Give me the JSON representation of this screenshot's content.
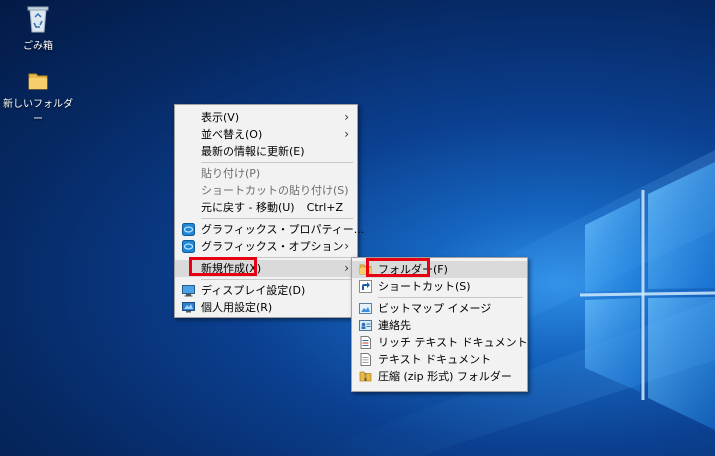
{
  "desktop": {
    "icons": [
      {
        "label": "ごみ箱",
        "icon": "recycle-bin-icon"
      },
      {
        "label": "新しいフォルダー",
        "icon": "folder-icon"
      }
    ]
  },
  "context_menu": {
    "items": [
      {
        "label": "表示(V)",
        "has_submenu": true
      },
      {
        "label": "並べ替え(O)",
        "has_submenu": true
      },
      {
        "label": "最新の情報に更新(E)"
      },
      {
        "label": "貼り付け(P)",
        "disabled": true
      },
      {
        "label": "ショートカットの貼り付け(S)",
        "disabled": true
      },
      {
        "label": "元に戻す - 移動(U)",
        "shortcut": "Ctrl+Z"
      },
      {
        "label": "グラフィックス・プロパティー...",
        "icon": "intel-graphics-icon"
      },
      {
        "label": "グラフィックス・オプション",
        "icon": "intel-graphics-icon",
        "has_submenu": true
      },
      {
        "label": "新規作成(X)",
        "has_submenu": true,
        "highlighted": true
      },
      {
        "label": "ディスプレイ設定(D)",
        "icon": "display-icon"
      },
      {
        "label": "個人用設定(R)",
        "icon": "personalize-icon"
      }
    ]
  },
  "new_submenu": {
    "items": [
      {
        "label": "フォルダー(F)",
        "icon": "folder-icon",
        "highlighted": true
      },
      {
        "label": "ショートカット(S)",
        "icon": "shortcut-icon"
      },
      {
        "label": "ビットマップ イメージ",
        "icon": "bitmap-icon"
      },
      {
        "label": "連絡先",
        "icon": "contact-icon"
      },
      {
        "label": "リッチ テキスト ドキュメント",
        "icon": "rich-text-icon"
      },
      {
        "label": "テキスト ドキュメント",
        "icon": "text-document-icon"
      },
      {
        "label": "圧縮 (zip 形式) フォルダー",
        "icon": "zip-folder-icon"
      }
    ]
  },
  "colors": {
    "highlight_box": "#e60012",
    "menu_background": "#f2f2f2",
    "desktop_blue": "#0b3f8f"
  }
}
